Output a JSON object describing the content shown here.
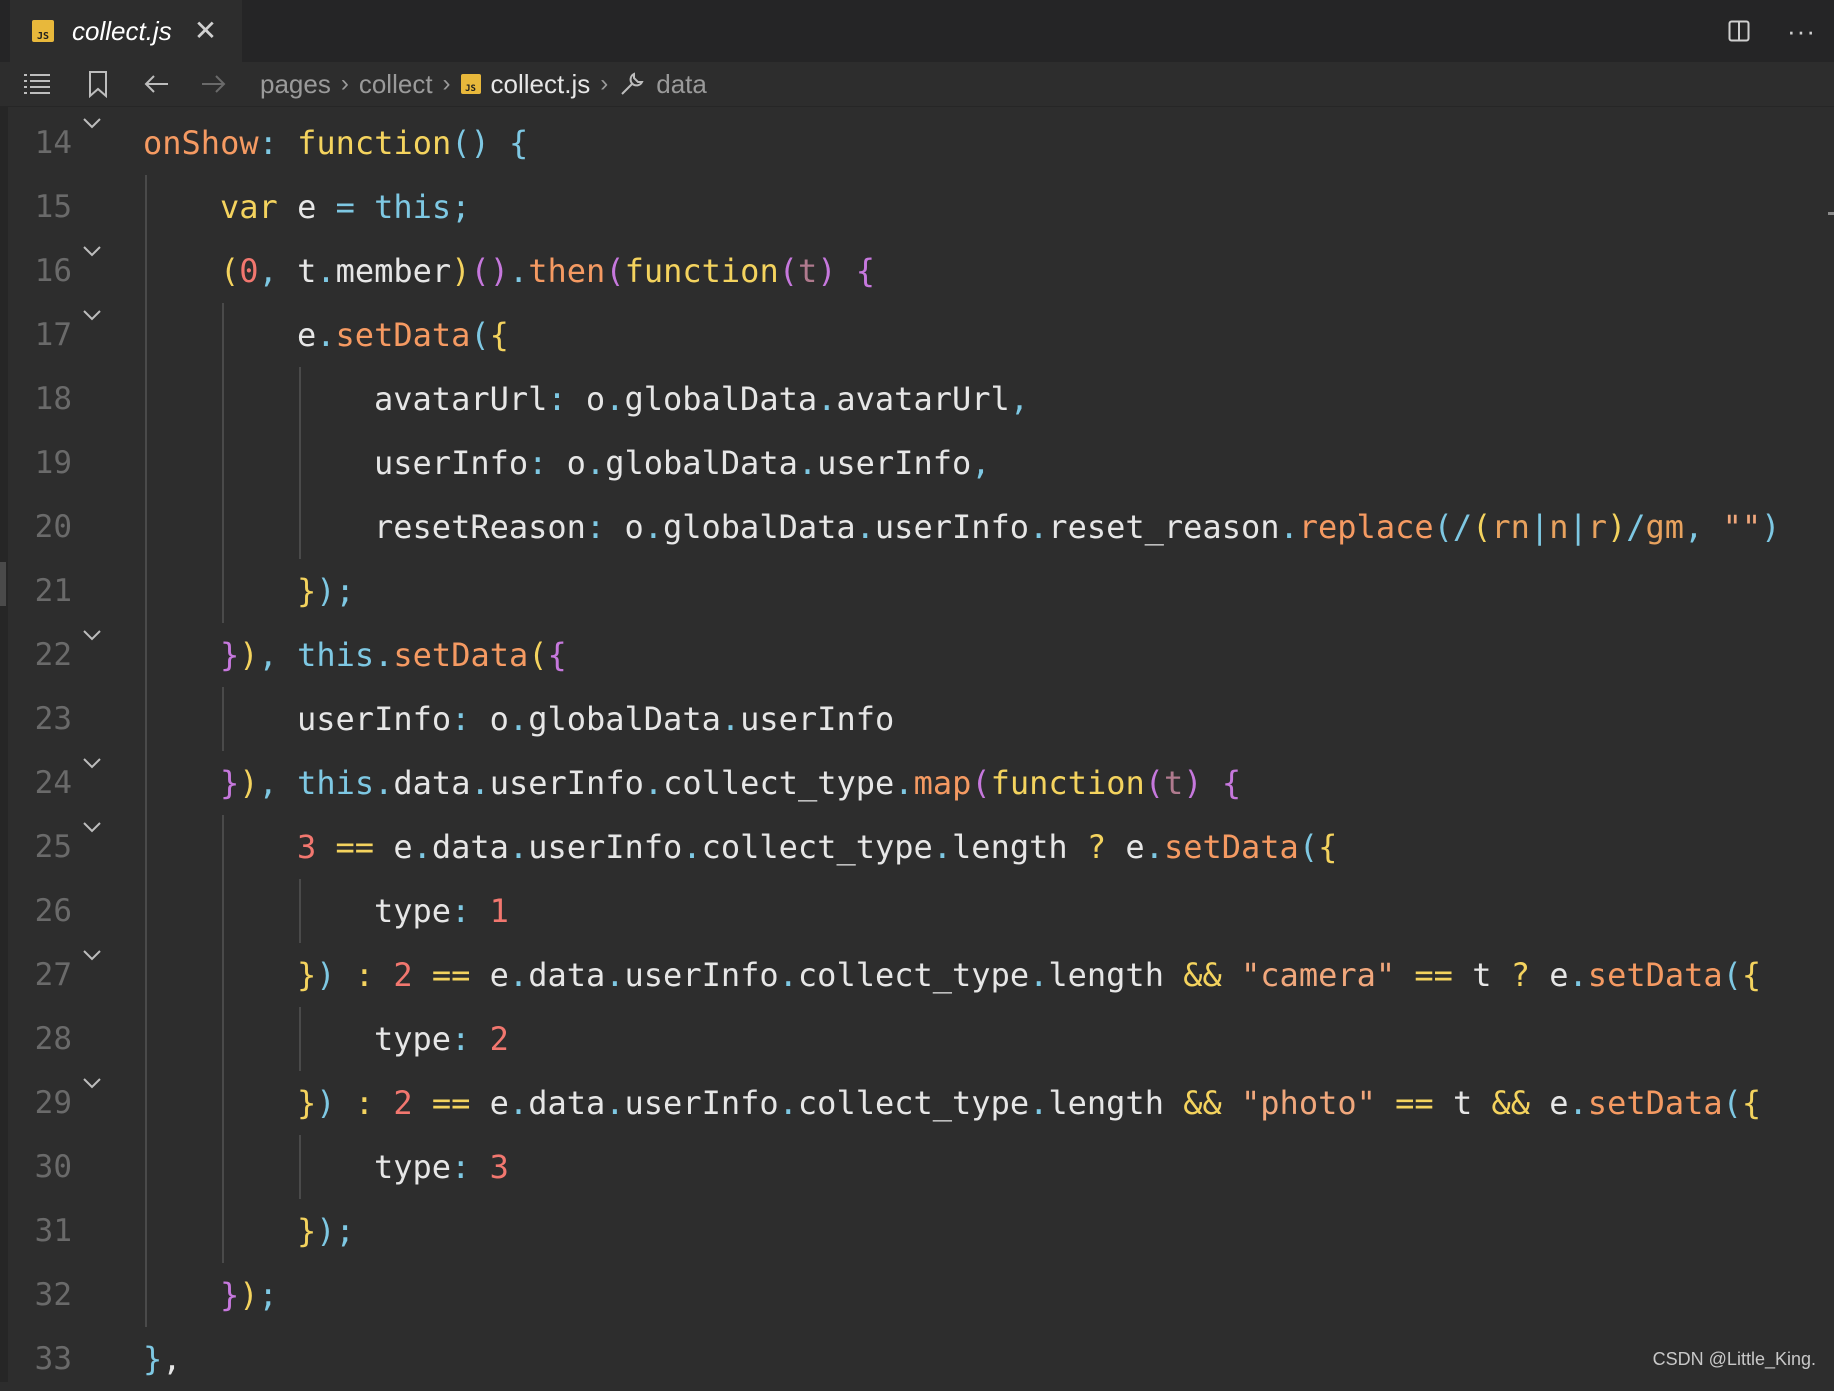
{
  "tab": {
    "title": "collect.js",
    "badge": "JS"
  },
  "breadcrumb": {
    "items": [
      "pages",
      "collect",
      "collect.js",
      "data"
    ],
    "badge": "JS"
  },
  "icons": {
    "list": "list-icon",
    "bookmark": "bookmark-icon",
    "back": "arrow-left-icon",
    "forward": "arrow-right-icon",
    "split": "split-editor-icon",
    "more": "more-icon",
    "close": "close-icon",
    "wrench": "wrench-icon",
    "fold": "chevron-down-icon"
  },
  "more_label": "···",
  "close_label": "✕",
  "watermark": "CSDN @Little_King.",
  "code_lines": [
    {
      "no": "14",
      "fold": true,
      "indent": 0,
      "tokens": [
        [
          "p",
          "onShow"
        ],
        [
          "b",
          ": "
        ],
        [
          "y",
          "function"
        ],
        [
          "b",
          "() {"
        ]
      ]
    },
    {
      "no": "15",
      "fold": false,
      "indent": 1,
      "tokens": [
        [
          "y",
          "var"
        ],
        [
          "w",
          " e "
        ],
        [
          "b",
          "= "
        ],
        [
          "b",
          "this"
        ],
        [
          "b",
          ";"
        ]
      ]
    },
    {
      "no": "16",
      "fold": true,
      "indent": 1,
      "tokens": [
        [
          "y",
          "("
        ],
        [
          "n",
          "0"
        ],
        [
          "b",
          ", "
        ],
        [
          "w",
          "t"
        ],
        [
          "b",
          "."
        ],
        [
          "w",
          "member"
        ],
        [
          "y",
          ")"
        ],
        [
          "m",
          "()"
        ],
        [
          "b",
          "."
        ],
        [
          "p",
          "then"
        ],
        [
          "m",
          "("
        ],
        [
          "y",
          "function"
        ],
        [
          "m",
          "("
        ],
        [
          "pr",
          "t"
        ],
        [
          "m",
          ")"
        ],
        [
          "w",
          " "
        ],
        [
          "m",
          "{"
        ]
      ]
    },
    {
      "no": "17",
      "fold": true,
      "indent": 2,
      "tokens": [
        [
          "w",
          "e"
        ],
        [
          "b",
          "."
        ],
        [
          "p",
          "setData"
        ],
        [
          "b",
          "("
        ],
        [
          "y",
          "{"
        ]
      ]
    },
    {
      "no": "18",
      "fold": false,
      "indent": 3,
      "tokens": [
        [
          "w",
          "avatarUrl"
        ],
        [
          "b",
          ": "
        ],
        [
          "w",
          "o"
        ],
        [
          "b",
          "."
        ],
        [
          "w",
          "globalData"
        ],
        [
          "b",
          "."
        ],
        [
          "w",
          "avatarUrl"
        ],
        [
          "b",
          ","
        ]
      ]
    },
    {
      "no": "19",
      "fold": false,
      "indent": 3,
      "tokens": [
        [
          "w",
          "userInfo"
        ],
        [
          "b",
          ": "
        ],
        [
          "w",
          "o"
        ],
        [
          "b",
          "."
        ],
        [
          "w",
          "globalData"
        ],
        [
          "b",
          "."
        ],
        [
          "w",
          "userInfo"
        ],
        [
          "b",
          ","
        ]
      ]
    },
    {
      "no": "20",
      "fold": false,
      "indent": 3,
      "tokens": [
        [
          "w",
          "resetReason"
        ],
        [
          "b",
          ": "
        ],
        [
          "w",
          "o"
        ],
        [
          "b",
          "."
        ],
        [
          "w",
          "globalData"
        ],
        [
          "b",
          "."
        ],
        [
          "w",
          "userInfo"
        ],
        [
          "b",
          "."
        ],
        [
          "w",
          "reset_reason"
        ],
        [
          "b",
          "."
        ],
        [
          "p",
          "replace"
        ],
        [
          "b",
          "("
        ],
        [
          "rb",
          "/"
        ],
        [
          "yb",
          "("
        ],
        [
          "rx",
          "rn"
        ],
        [
          "rb",
          "|"
        ],
        [
          "rx",
          "n"
        ],
        [
          "rb",
          "|"
        ],
        [
          "rx",
          "r"
        ],
        [
          "yb",
          ")"
        ],
        [
          "rb",
          "/"
        ],
        [
          "rx",
          "gm"
        ],
        [
          "b",
          ", "
        ],
        [
          "s",
          "\"\""
        ],
        [
          "b",
          ")"
        ]
      ]
    },
    {
      "no": "21",
      "fold": false,
      "indent": 2,
      "tokens": [
        [
          "y",
          "}"
        ],
        [
          "b",
          ");"
        ]
      ]
    },
    {
      "no": "22",
      "fold": true,
      "indent": 1,
      "tokens": [
        [
          "m",
          "}"
        ],
        [
          "y",
          ")"
        ],
        [
          "b",
          ", "
        ],
        [
          "b",
          "this"
        ],
        [
          "b",
          "."
        ],
        [
          "p",
          "setData"
        ],
        [
          "y",
          "("
        ],
        [
          "m",
          "{"
        ]
      ]
    },
    {
      "no": "23",
      "fold": false,
      "indent": 2,
      "tokens": [
        [
          "w",
          "userInfo"
        ],
        [
          "b",
          ": "
        ],
        [
          "w",
          "o"
        ],
        [
          "b",
          "."
        ],
        [
          "w",
          "globalData"
        ],
        [
          "b",
          "."
        ],
        [
          "w",
          "userInfo"
        ]
      ]
    },
    {
      "no": "24",
      "fold": true,
      "indent": 1,
      "tokens": [
        [
          "m",
          "}"
        ],
        [
          "y",
          ")"
        ],
        [
          "b",
          ", "
        ],
        [
          "b",
          "this"
        ],
        [
          "b",
          "."
        ],
        [
          "w",
          "data"
        ],
        [
          "b",
          "."
        ],
        [
          "w",
          "userInfo"
        ],
        [
          "b",
          "."
        ],
        [
          "w",
          "collect_type"
        ],
        [
          "b",
          "."
        ],
        [
          "p",
          "map"
        ],
        [
          "m",
          "("
        ],
        [
          "y",
          "function"
        ],
        [
          "m",
          "("
        ],
        [
          "pr",
          "t"
        ],
        [
          "m",
          ")"
        ],
        [
          "w",
          " "
        ],
        [
          "m",
          "{"
        ]
      ]
    },
    {
      "no": "25",
      "fold": true,
      "indent": 2,
      "tokens": [
        [
          "n",
          "3"
        ],
        [
          "w",
          " "
        ],
        [
          "y",
          "=="
        ],
        [
          "w",
          " e"
        ],
        [
          "b",
          "."
        ],
        [
          "w",
          "data"
        ],
        [
          "b",
          "."
        ],
        [
          "w",
          "userInfo"
        ],
        [
          "b",
          "."
        ],
        [
          "w",
          "collect_type"
        ],
        [
          "b",
          "."
        ],
        [
          "w",
          "length "
        ],
        [
          "y",
          "?"
        ],
        [
          "w",
          " e"
        ],
        [
          "b",
          "."
        ],
        [
          "p",
          "setData"
        ],
        [
          "b",
          "("
        ],
        [
          "y",
          "{"
        ]
      ]
    },
    {
      "no": "26",
      "fold": false,
      "indent": 3,
      "tokens": [
        [
          "w",
          "type"
        ],
        [
          "b",
          ": "
        ],
        [
          "n",
          "1"
        ]
      ]
    },
    {
      "no": "27",
      "fold": true,
      "indent": 2,
      "tokens": [
        [
          "y",
          "}"
        ],
        [
          "b",
          ")"
        ],
        [
          "w",
          " "
        ],
        [
          "y",
          ":"
        ],
        [
          "w",
          " "
        ],
        [
          "n",
          "2"
        ],
        [
          "w",
          " "
        ],
        [
          "y",
          "=="
        ],
        [
          "w",
          " e"
        ],
        [
          "b",
          "."
        ],
        [
          "w",
          "data"
        ],
        [
          "b",
          "."
        ],
        [
          "w",
          "userInfo"
        ],
        [
          "b",
          "."
        ],
        [
          "w",
          "collect_type"
        ],
        [
          "b",
          "."
        ],
        [
          "w",
          "length "
        ],
        [
          "y",
          "&&"
        ],
        [
          "w",
          " "
        ],
        [
          "s",
          "\"camera\""
        ],
        [
          "w",
          " "
        ],
        [
          "y",
          "=="
        ],
        [
          "w",
          " t "
        ],
        [
          "y",
          "?"
        ],
        [
          "w",
          " e"
        ],
        [
          "b",
          "."
        ],
        [
          "p",
          "setData"
        ],
        [
          "b",
          "("
        ],
        [
          "y",
          "{"
        ]
      ]
    },
    {
      "no": "28",
      "fold": false,
      "indent": 3,
      "tokens": [
        [
          "w",
          "type"
        ],
        [
          "b",
          ": "
        ],
        [
          "n",
          "2"
        ]
      ]
    },
    {
      "no": "29",
      "fold": true,
      "indent": 2,
      "tokens": [
        [
          "y",
          "}"
        ],
        [
          "b",
          ")"
        ],
        [
          "w",
          " "
        ],
        [
          "y",
          ":"
        ],
        [
          "w",
          " "
        ],
        [
          "n",
          "2"
        ],
        [
          "w",
          " "
        ],
        [
          "y",
          "=="
        ],
        [
          "w",
          " e"
        ],
        [
          "b",
          "."
        ],
        [
          "w",
          "data"
        ],
        [
          "b",
          "."
        ],
        [
          "w",
          "userInfo"
        ],
        [
          "b",
          "."
        ],
        [
          "w",
          "collect_type"
        ],
        [
          "b",
          "."
        ],
        [
          "w",
          "length "
        ],
        [
          "y",
          "&&"
        ],
        [
          "w",
          " "
        ],
        [
          "s",
          "\"photo\""
        ],
        [
          "w",
          " "
        ],
        [
          "y",
          "=="
        ],
        [
          "w",
          " t "
        ],
        [
          "y",
          "&&"
        ],
        [
          "w",
          " e"
        ],
        [
          "b",
          "."
        ],
        [
          "p",
          "setData"
        ],
        [
          "b",
          "("
        ],
        [
          "y",
          "{"
        ]
      ]
    },
    {
      "no": "30",
      "fold": false,
      "indent": 3,
      "tokens": [
        [
          "w",
          "type"
        ],
        [
          "b",
          ": "
        ],
        [
          "n",
          "3"
        ]
      ]
    },
    {
      "no": "31",
      "fold": false,
      "indent": 2,
      "tokens": [
        [
          "y",
          "}"
        ],
        [
          "b",
          ");"
        ]
      ]
    },
    {
      "no": "32",
      "fold": false,
      "indent": 1,
      "tokens": [
        [
          "m",
          "}"
        ],
        [
          "y",
          ")"
        ],
        [
          "b",
          ";"
        ]
      ]
    },
    {
      "no": "33",
      "fold": false,
      "indent": 0,
      "tokens": [
        [
          "b",
          "}"
        ],
        [
          "w",
          ","
        ]
      ]
    }
  ]
}
